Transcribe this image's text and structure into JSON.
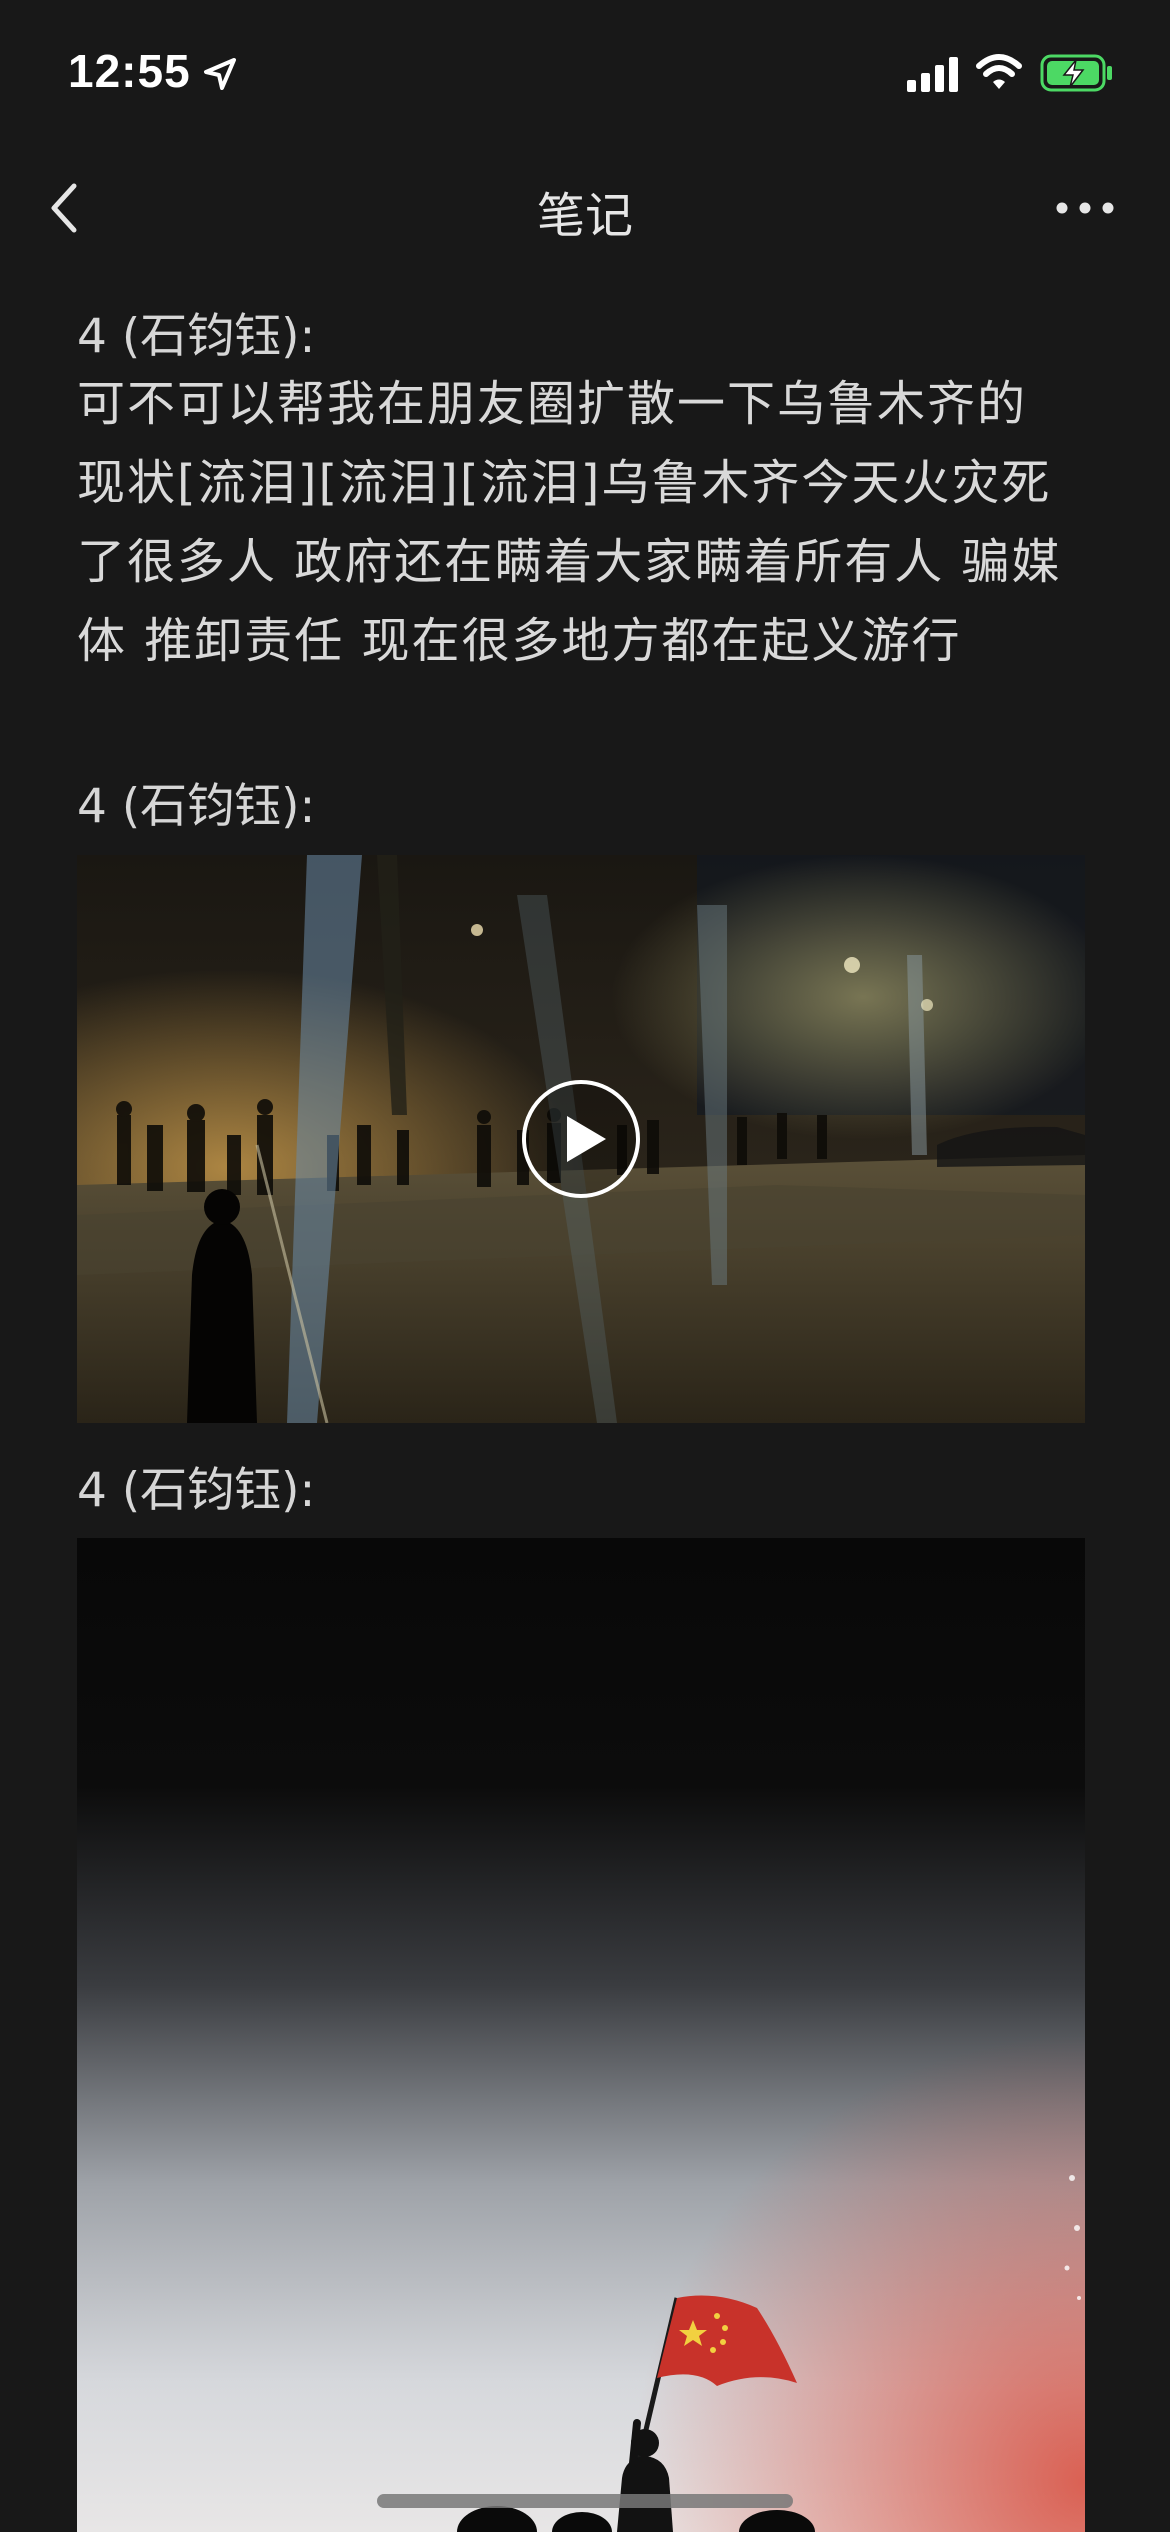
{
  "status_bar": {
    "time": "12:55",
    "icons": [
      "location-arrow-icon",
      "cellular-signal-icon",
      "wifi-icon",
      "battery-charging-icon"
    ],
    "battery_color": "#4cd964"
  },
  "nav": {
    "title": "笔记",
    "back_icon": "chevron-left-icon",
    "more_icon": "more-dots-icon"
  },
  "messages": [
    {
      "sender": "4 (石钧钰):",
      "type": "text",
      "lines": [
        "可不可以帮我在朋友圈扩散一下乌鲁木齐的",
        "现状[流泪][流泪][流泪]乌鲁木齐今天火灾死",
        "了很多人 政府还在瞒着大家瞒着所有人 骗媒",
        "体 推卸责任 现在很多地方都在起义游行"
      ]
    },
    {
      "sender": "4 (石钧钰):",
      "type": "video",
      "play_icon": "play-icon"
    },
    {
      "sender": "4 (石钧钰):",
      "type": "image"
    }
  ],
  "colors": {
    "background": "#181818",
    "text": "#d9d9d9"
  }
}
